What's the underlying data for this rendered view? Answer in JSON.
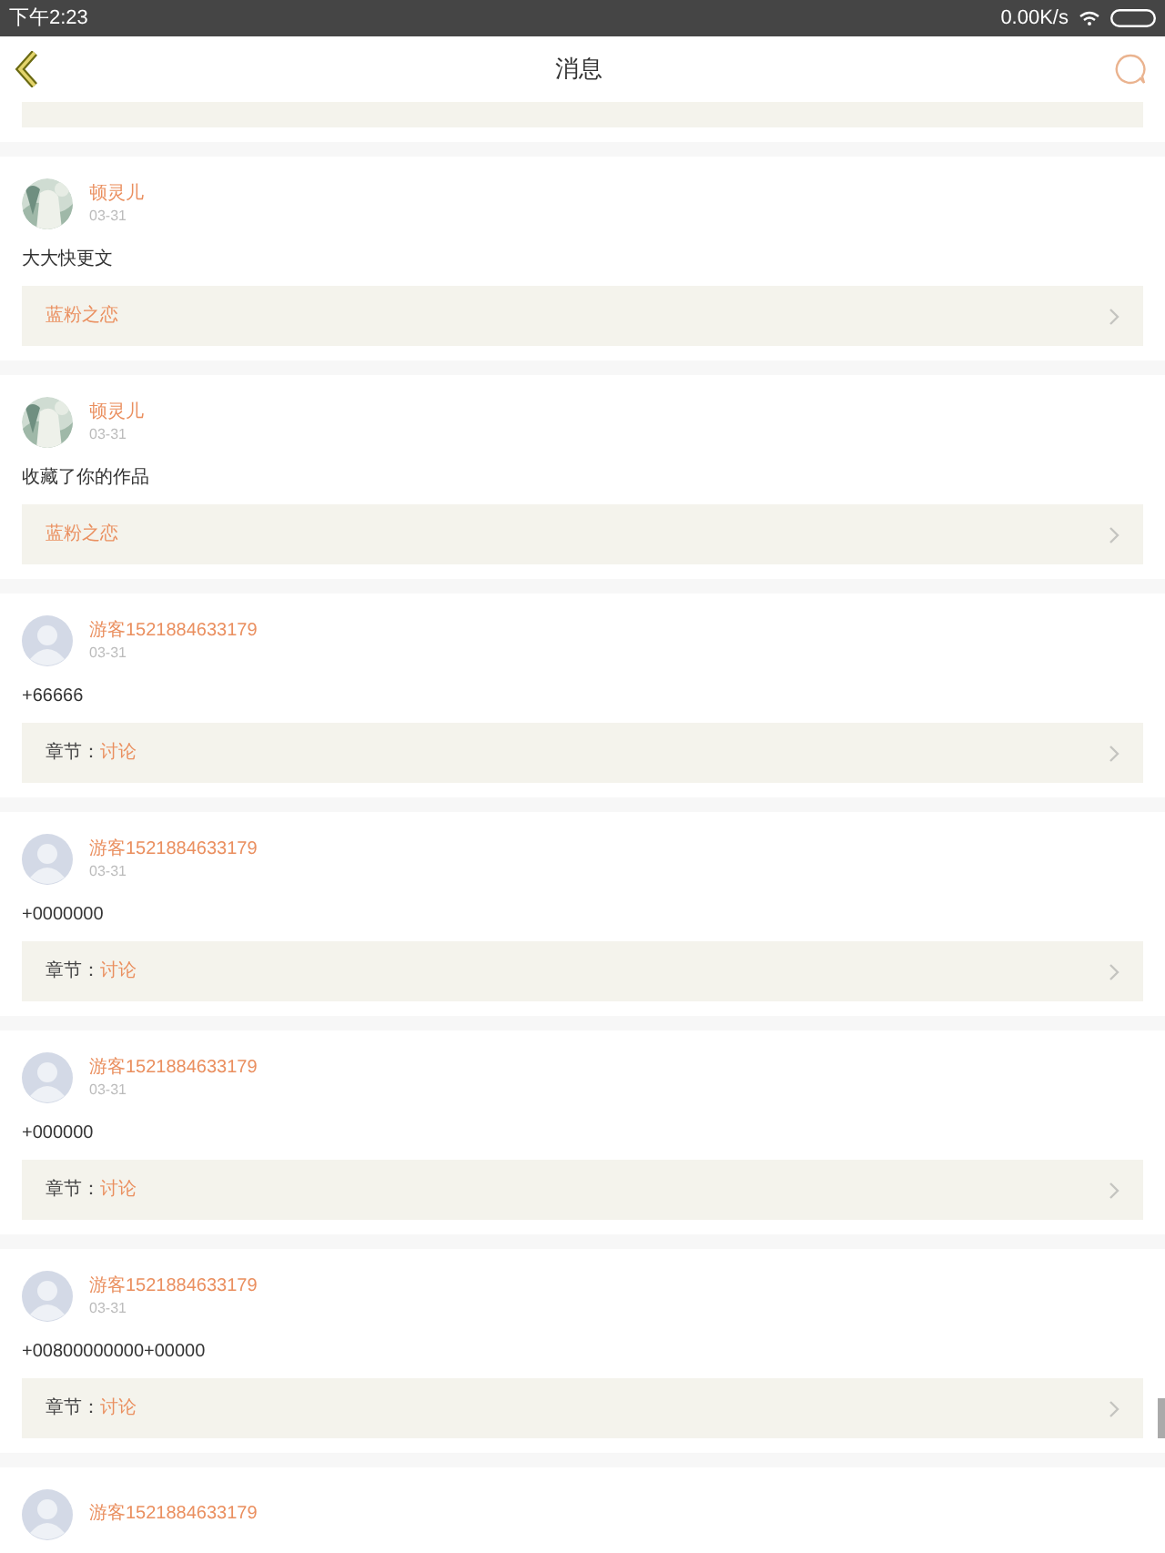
{
  "status_bar": {
    "time": "下午2:23",
    "speed": "0.00K/s"
  },
  "nav": {
    "title": "消息"
  },
  "messages": [
    {
      "user": "顿灵儿",
      "date": "03-31",
      "text": "大大快更文",
      "link": {
        "kind": "work",
        "title": "蓝粉之恋"
      }
    },
    {
      "user": "顿灵儿",
      "date": "03-31",
      "text": "收藏了你的作品",
      "link": {
        "kind": "work",
        "title": "蓝粉之恋"
      }
    },
    {
      "avatar": {
        "kind": "default"
      },
      "user": "游客1521884633179",
      "date": "03-31",
      "text": "+66666",
      "link": {
        "kind": "chapter",
        "label": "章节：",
        "title": "讨论"
      }
    },
    {
      "avatar": {
        "kind": "default"
      },
      "user": "游客1521884633179",
      "date": "03-31",
      "text": "+0000000",
      "link": {
        "kind": "chapter",
        "label": "章节：",
        "title": "讨论"
      }
    },
    {
      "avatar": {
        "kind": "default"
      },
      "user": "游客1521884633179",
      "date": "03-31",
      "text": "+000000",
      "link": {
        "kind": "chapter",
        "label": "章节：",
        "title": "讨论"
      }
    },
    {
      "avatar": {
        "kind": "default"
      },
      "user": "游客1521884633179",
      "date": "03-31",
      "text": "+00800000000+00000",
      "link": {
        "kind": "chapter",
        "label": "章节：",
        "title": "讨论"
      }
    },
    {
      "avatar": {
        "kind": "default"
      },
      "user": "游客1521884633179"
    }
  ]
}
